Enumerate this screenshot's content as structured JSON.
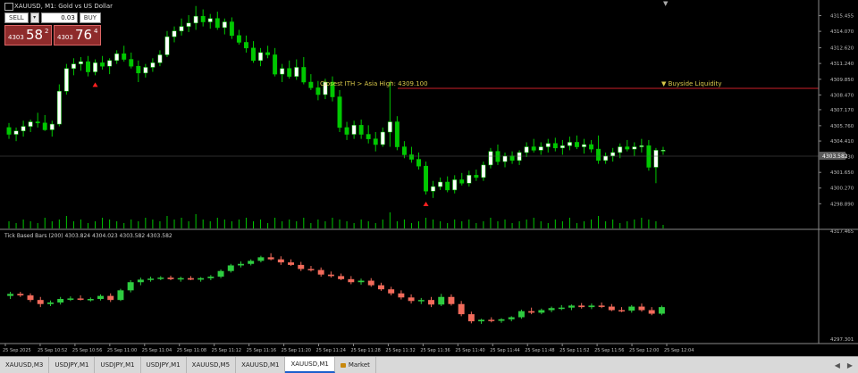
{
  "window": {
    "title": "XAUUSD, M1:  Gold vs US Dollar",
    "top_arrow": "▼"
  },
  "trade_panel": {
    "sell_label": "SELL",
    "buy_label": "BUY",
    "lot": "0.03",
    "lot_arrow": "▾",
    "sell_prefix": "4303",
    "sell_big": "58",
    "sell_sup": "2",
    "buy_prefix": "4303",
    "buy_big": "76",
    "buy_sup": "4"
  },
  "annotations": {
    "liquidity_label": "Closest ITH > Asia High: 4309.100",
    "buyside_label": "▼ Buyside Liquidity"
  },
  "indicator": {
    "title": "Tick Based Bars (200) 4303.824 4304.023 4303.582 4303.582"
  },
  "price_axis": [
    "4315.455",
    "4314.070",
    "4312.620",
    "4311.240",
    "4309.850",
    "4308.470",
    "4307.170",
    "4305.760",
    "4304.410",
    "4303.030",
    "4301.650",
    "4300.270",
    "4298.890"
  ],
  "current_price": "4303.582",
  "indicator_axis": [
    "4317.465",
    "4297.301"
  ],
  "time_axis": [
    "25 Sep 2025",
    "25 Sep 10:52",
    "25 Sep 10:56",
    "25 Sep 11:00",
    "25 Sep 11:04",
    "25 Sep 11:08",
    "25 Sep 11:12",
    "25 Sep 11:16",
    "25 Sep 11:20",
    "25 Sep 11:24",
    "25 Sep 11:28",
    "25 Sep 11:32",
    "25 Sep 11:36",
    "25 Sep 11:40",
    "25 Sep 11:44",
    "25 Sep 11:48",
    "25 Sep 11:52",
    "25 Sep 11:56",
    "25 Sep 12:00",
    "25 Sep 12:04"
  ],
  "tabs": [
    {
      "label": "XAUUSD,M3",
      "active": false
    },
    {
      "label": "USDJPY,M1",
      "active": false
    },
    {
      "label": "USDJPY,M1",
      "active": false
    },
    {
      "label": "USDJPY,M1",
      "active": false
    },
    {
      "label": "XAUUSD,M5",
      "active": false
    },
    {
      "label": "XAUUSD,M1",
      "active": false
    },
    {
      "label": "XAUUSD,M1",
      "active": true
    },
    {
      "label": "Market",
      "active": false,
      "lock": true
    }
  ],
  "colors": {
    "bull": "#ffffff",
    "bear": "#00c800",
    "ind_bull": "#2ecc40",
    "ind_bear": "#f26b5b",
    "level": "#cc1f2a",
    "label": "#d9c84a"
  },
  "chart_data": {
    "type": "candlestick",
    "main_ylim": [
      4298.6,
      4316.2
    ],
    "main_candles": [
      [
        4305.6,
        4306.0,
        4304.6,
        4305.0
      ],
      [
        4305.0,
        4305.6,
        4304.4,
        4305.3
      ],
      [
        4305.3,
        4306.2,
        4304.8,
        4305.7
      ],
      [
        4305.7,
        4306.3,
        4305.2,
        4306.1
      ],
      [
        4306.1,
        4306.9,
        4305.6,
        4306.0
      ],
      [
        4306.0,
        4306.7,
        4305.3,
        4305.4
      ],
      [
        4305.4,
        4306.2,
        4304.8,
        4305.9
      ],
      [
        4305.9,
        4309.4,
        4305.7,
        4308.8
      ],
      [
        4308.8,
        4311.2,
        4308.5,
        4310.8
      ],
      [
        4310.8,
        4311.7,
        4310.2,
        4311.2
      ],
      [
        4311.2,
        4311.8,
        4310.6,
        4311.4
      ],
      [
        4311.4,
        4311.9,
        4310.1,
        4310.5
      ],
      [
        4310.5,
        4311.6,
        4310.2,
        4311.3
      ],
      [
        4311.3,
        4311.9,
        4310.7,
        4311.0
      ],
      [
        4311.0,
        4311.7,
        4310.3,
        4311.5
      ],
      [
        4311.5,
        4312.4,
        4311.2,
        4312.1
      ],
      [
        4312.1,
        4312.8,
        4311.4,
        4311.6
      ],
      [
        4311.6,
        4312.2,
        4310.8,
        4311.0
      ],
      [
        4311.0,
        4311.5,
        4309.6,
        4310.4
      ],
      [
        4310.4,
        4311.2,
        4310.0,
        4310.9
      ],
      [
        4310.9,
        4311.7,
        4310.5,
        4311.3
      ],
      [
        4311.3,
        4312.4,
        4311.0,
        4312.0
      ],
      [
        4312.0,
        4314.1,
        4311.8,
        4313.6
      ],
      [
        4313.6,
        4314.5,
        4313.1,
        4314.1
      ],
      [
        4314.1,
        4315.2,
        4313.7,
        4314.5
      ],
      [
        4314.5,
        4315.5,
        4314.0,
        4314.8
      ],
      [
        4314.8,
        4316.3,
        4314.2,
        4315.4
      ],
      [
        4315.4,
        4316.0,
        4314.5,
        4314.9
      ],
      [
        4314.9,
        4315.6,
        4314.3,
        4315.2
      ],
      [
        4315.2,
        4315.8,
        4314.2,
        4314.4
      ],
      [
        4314.4,
        4315.2,
        4313.8,
        4314.9
      ],
      [
        4314.9,
        4315.3,
        4313.4,
        4313.7
      ],
      [
        4313.7,
        4314.2,
        4312.9,
        4313.1
      ],
      [
        4313.1,
        4313.7,
        4312.2,
        4312.6
      ],
      [
        4312.6,
        4313.2,
        4311.3,
        4311.5
      ],
      [
        4311.5,
        4312.6,
        4311.0,
        4312.2
      ],
      [
        4312.2,
        4312.8,
        4311.7,
        4312.0
      ],
      [
        4312.0,
        4312.6,
        4310.1,
        4310.3
      ],
      [
        4310.3,
        4311.2,
        4309.6,
        4310.8
      ],
      [
        4310.8,
        4311.5,
        4309.9,
        4310.1
      ],
      [
        4310.1,
        4311.6,
        4309.8,
        4310.9
      ],
      [
        4310.9,
        4311.8,
        4309.4,
        4309.6
      ],
      [
        4309.6,
        4310.3,
        4308.9,
        4309.1
      ],
      [
        4309.1,
        4309.7,
        4308.0,
        4308.5
      ],
      [
        4308.5,
        4309.9,
        4308.1,
        4309.6
      ],
      [
        4309.6,
        4310.1,
        4307.9,
        4308.3
      ],
      [
        4308.3,
        4308.9,
        4305.2,
        4305.6
      ],
      [
        4305.6,
        4306.1,
        4304.5,
        4305.0
      ],
      [
        4305.0,
        4306.2,
        4304.6,
        4305.8
      ],
      [
        4305.8,
        4306.3,
        4304.6,
        4305.0
      ],
      [
        4305.0,
        4305.8,
        4304.2,
        4304.6
      ],
      [
        4304.6,
        4305.2,
        4303.5,
        4304.1
      ],
      [
        4304.1,
        4305.6,
        4303.9,
        4305.2
      ],
      [
        4305.2,
        4309.6,
        4303.9,
        4306.1
      ],
      [
        4306.1,
        4306.6,
        4303.6,
        4303.9
      ],
      [
        4303.9,
        4304.4,
        4302.9,
        4303.2
      ],
      [
        4303.2,
        4303.9,
        4302.5,
        4302.8
      ],
      [
        4302.8,
        4303.4,
        4301.9,
        4302.2
      ],
      [
        4302.2,
        4302.6,
        4299.7,
        4300.0
      ],
      [
        4300.0,
        4300.9,
        4299.4,
        4300.4
      ],
      [
        4300.4,
        4301.2,
        4300.1,
        4300.8
      ],
      [
        4300.8,
        4301.3,
        4299.9,
        4300.1
      ],
      [
        4300.1,
        4301.4,
        4299.8,
        4301.0
      ],
      [
        4301.0,
        4301.6,
        4300.5,
        4300.7
      ],
      [
        4300.7,
        4301.8,
        4300.4,
        4301.4
      ],
      [
        4301.4,
        4301.9,
        4300.9,
        4301.2
      ],
      [
        4301.2,
        4302.6,
        4300.9,
        4302.3
      ],
      [
        4302.3,
        4303.8,
        4302.0,
        4303.5
      ],
      [
        4303.5,
        4304.1,
        4302.3,
        4302.6
      ],
      [
        4302.6,
        4303.4,
        4302.1,
        4303.1
      ],
      [
        4303.1,
        4303.5,
        4302.4,
        4302.7
      ],
      [
        4302.7,
        4303.6,
        4302.3,
        4303.4
      ],
      [
        4303.4,
        4304.3,
        4303.0,
        4303.9
      ],
      [
        4303.9,
        4304.6,
        4303.4,
        4303.6
      ],
      [
        4303.6,
        4304.3,
        4303.2,
        4303.9
      ],
      [
        4303.9,
        4304.6,
        4303.4,
        4304.2
      ],
      [
        4304.2,
        4304.7,
        4303.5,
        4303.8
      ],
      [
        4303.8,
        4304.5,
        4303.2,
        4304.0
      ],
      [
        4304.0,
        4304.8,
        4303.6,
        4304.3
      ],
      [
        4304.3,
        4304.9,
        4303.7,
        4303.9
      ],
      [
        4303.9,
        4304.6,
        4303.3,
        4304.1
      ],
      [
        4304.1,
        4304.5,
        4303.4,
        4303.7
      ],
      [
        4303.7,
        4304.9,
        4302.4,
        4302.7
      ],
      [
        4302.7,
        4303.4,
        4302.4,
        4303.1
      ],
      [
        4303.1,
        4303.8,
        4302.6,
        4303.4
      ],
      [
        4303.4,
        4304.2,
        4302.9,
        4303.9
      ],
      [
        4303.9,
        4304.5,
        4303.5,
        4303.7
      ],
      [
        4303.7,
        4304.3,
        4303.1,
        4303.9
      ],
      [
        4303.9,
        4304.6,
        4303.4,
        4304.0
      ],
      [
        4304.0,
        4304.5,
        4301.8,
        4302.1
      ],
      [
        4302.1,
        4303.8,
        4300.7,
        4303.6
      ],
      [
        4303.6,
        4303.9,
        4303.2,
        4303.6
      ]
    ],
    "volume": [
      0.4,
      0.3,
      0.5,
      0.4,
      0.3,
      0.6,
      0.4,
      0.5,
      0.7,
      0.4,
      0.5,
      0.3,
      0.4,
      0.6,
      0.5,
      0.4,
      0.3,
      0.5,
      0.4,
      0.6,
      0.5,
      0.4,
      0.7,
      0.5,
      0.6,
      0.4,
      0.8,
      0.5,
      0.4,
      0.6,
      0.5,
      0.4,
      0.5,
      0.6,
      0.4,
      0.5,
      0.3,
      0.6,
      0.4,
      0.5,
      0.4,
      0.6,
      0.3,
      0.5,
      0.4,
      0.6,
      0.5,
      0.4,
      0.3,
      0.5,
      0.4,
      0.3,
      0.5,
      0.9,
      0.4,
      0.5,
      0.3,
      0.4,
      0.6,
      0.5,
      0.4,
      0.3,
      0.5,
      0.4,
      0.5,
      0.3,
      0.4,
      0.6,
      0.4,
      0.5,
      0.3,
      0.4,
      0.5,
      0.6,
      0.4,
      0.3,
      0.5,
      0.4,
      0.6,
      0.3,
      0.4,
      0.5,
      0.7,
      0.4,
      0.5,
      0.3,
      0.4,
      0.5,
      0.6,
      0.5,
      0.4,
      0.2
    ],
    "arrows": [
      {
        "index": 12,
        "type": "up"
      },
      {
        "index": 58,
        "type": "up"
      }
    ],
    "ind_ylim": [
      4297.3,
      4317.5
    ],
    "ind_candles": [
      [
        4305.8,
        4306.6,
        4305.2,
        4306.2
      ],
      [
        4306.2,
        4306.6,
        4305.6,
        4305.9
      ],
      [
        4305.9,
        4306.3,
        4304.6,
        4305.0
      ],
      [
        4305.0,
        4305.6,
        4303.6,
        4304.2
      ],
      [
        4304.2,
        4304.9,
        4303.8,
        4304.5
      ],
      [
        4304.5,
        4305.6,
        4304.1,
        4305.2
      ],
      [
        4305.2,
        4305.7,
        4304.8,
        4305.3
      ],
      [
        4305.3,
        4305.9,
        4304.9,
        4305.1
      ],
      [
        4305.1,
        4305.5,
        4304.7,
        4305.2
      ],
      [
        4305.2,
        4306.1,
        4304.9,
        4305.8
      ],
      [
        4305.8,
        4306.3,
        4304.6,
        4305.0
      ],
      [
        4305.0,
        4307.2,
        4304.8,
        4306.9
      ],
      [
        4306.9,
        4308.9,
        4306.5,
        4308.5
      ],
      [
        4308.5,
        4309.4,
        4307.9,
        4309.0
      ],
      [
        4309.0,
        4309.6,
        4308.6,
        4309.2
      ],
      [
        4309.2,
        4309.7,
        4308.9,
        4309.4
      ],
      [
        4309.4,
        4309.8,
        4308.9,
        4309.1
      ],
      [
        4309.1,
        4309.6,
        4308.6,
        4309.3
      ],
      [
        4309.3,
        4309.7,
        4308.9,
        4309.0
      ],
      [
        4309.0,
        4309.5,
        4308.6,
        4309.3
      ],
      [
        4309.3,
        4309.9,
        4308.9,
        4309.6
      ],
      [
        4309.6,
        4311.0,
        4309.3,
        4310.7
      ],
      [
        4310.7,
        4312.1,
        4310.4,
        4311.8
      ],
      [
        4311.8,
        4312.6,
        4311.4,
        4312.1
      ],
      [
        4312.1,
        4313.0,
        4311.8,
        4312.7
      ],
      [
        4312.7,
        4313.7,
        4312.4,
        4313.4
      ],
      [
        4313.4,
        4314.2,
        4312.8,
        4313.0
      ],
      [
        4313.0,
        4313.6,
        4311.9,
        4312.4
      ],
      [
        4312.4,
        4313.0,
        4311.7,
        4311.9
      ],
      [
        4311.9,
        4312.5,
        4310.7,
        4311.1
      ],
      [
        4311.1,
        4311.7,
        4310.6,
        4310.9
      ],
      [
        4310.9,
        4311.4,
        4309.6,
        4310.0
      ],
      [
        4310.0,
        4310.6,
        4309.4,
        4309.7
      ],
      [
        4309.7,
        4310.2,
        4308.9,
        4309.1
      ],
      [
        4309.1,
        4309.7,
        4308.1,
        4308.5
      ],
      [
        4308.5,
        4309.2,
        4308.0,
        4308.8
      ],
      [
        4308.8,
        4309.3,
        4307.6,
        4307.9
      ],
      [
        4307.9,
        4308.4,
        4306.8,
        4307.1
      ],
      [
        4307.1,
        4307.6,
        4305.9,
        4306.3
      ],
      [
        4306.3,
        4306.9,
        4305.1,
        4305.5
      ],
      [
        4305.5,
        4306.1,
        4304.3,
        4304.8
      ],
      [
        4304.8,
        4305.4,
        4304.2,
        4305.0
      ],
      [
        4305.0,
        4305.6,
        4303.6,
        4304.1
      ],
      [
        4304.1,
        4306.2,
        4303.8,
        4305.6
      ],
      [
        4305.6,
        4306.1,
        4303.9,
        4304.2
      ],
      [
        4304.2,
        4304.8,
        4301.8,
        4302.2
      ],
      [
        4302.2,
        4302.7,
        4300.4,
        4300.8
      ],
      [
        4300.8,
        4301.3,
        4300.3,
        4301.1
      ],
      [
        4301.1,
        4301.6,
        4300.6,
        4300.9
      ],
      [
        4300.9,
        4301.4,
        4300.5,
        4301.2
      ],
      [
        4301.2,
        4301.8,
        4300.8,
        4301.6
      ],
      [
        4301.6,
        4303.1,
        4301.3,
        4302.8
      ],
      [
        4302.8,
        4303.5,
        4302.2,
        4302.5
      ],
      [
        4302.5,
        4303.3,
        4302.2,
        4303.0
      ],
      [
        4303.0,
        4303.7,
        4302.6,
        4303.4
      ],
      [
        4303.4,
        4304.0,
        4303.0,
        4303.5
      ],
      [
        4303.5,
        4304.1,
        4303.0,
        4303.9
      ],
      [
        4303.9,
        4304.4,
        4303.3,
        4303.6
      ],
      [
        4303.6,
        4304.3,
        4303.2,
        4303.9
      ],
      [
        4303.9,
        4304.5,
        4303.4,
        4303.7
      ],
      [
        4303.7,
        4304.2,
        4302.8,
        4303.0
      ],
      [
        4303.0,
        4303.6,
        4302.6,
        4302.9
      ],
      [
        4302.9,
        4304.0,
        4302.5,
        4303.7
      ],
      [
        4303.7,
        4304.3,
        4302.7,
        4303.0
      ],
      [
        4303.0,
        4303.6,
        4302.0,
        4302.3
      ],
      [
        4302.3,
        4303.9,
        4302.0,
        4303.6
      ]
    ]
  }
}
